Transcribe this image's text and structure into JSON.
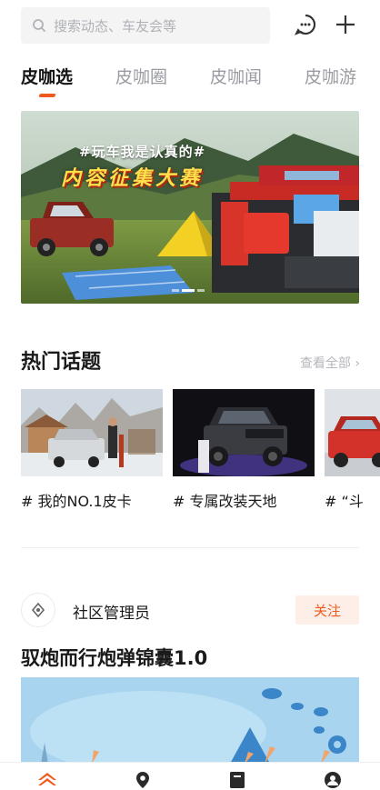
{
  "search": {
    "placeholder": "搜索动态、车友会等",
    "icon": "search-icon"
  },
  "header_actions": [
    {
      "icon": "message-bubble-icon"
    },
    {
      "icon": "plus-icon"
    }
  ],
  "tabs": [
    {
      "label": "皮咖选",
      "active": true
    },
    {
      "label": "皮咖圈",
      "active": false
    },
    {
      "label": "皮咖闻",
      "active": false
    },
    {
      "label": "皮咖游",
      "active": false
    }
  ],
  "banner": {
    "hashtag": "#玩车我是认真的#",
    "title": "内容征集大赛",
    "slide_count": 3,
    "active_slide": 2
  },
  "hot_topics": {
    "title": "热门话题",
    "see_all": "查看全部 ›",
    "items": [
      {
        "label": "# 我的NO.1皮卡"
      },
      {
        "label": "# 专属改装天地"
      },
      {
        "label": "# “斗"
      }
    ]
  },
  "post": {
    "author": "社区管理员",
    "follow_label": "关注",
    "title": "驭炮而行炮弹锦囊1.0"
  },
  "bottom_nav": [
    {
      "icon": "home-icon",
      "active": true
    },
    {
      "icon": "location-pin-icon",
      "active": false
    },
    {
      "icon": "bookmark-icon",
      "active": false
    },
    {
      "icon": "profile-icon",
      "active": false
    }
  ],
  "colors": {
    "accent": "#f05a1e",
    "follow_bg": "#fdeee7",
    "muted_text": "#9a9ca2"
  }
}
